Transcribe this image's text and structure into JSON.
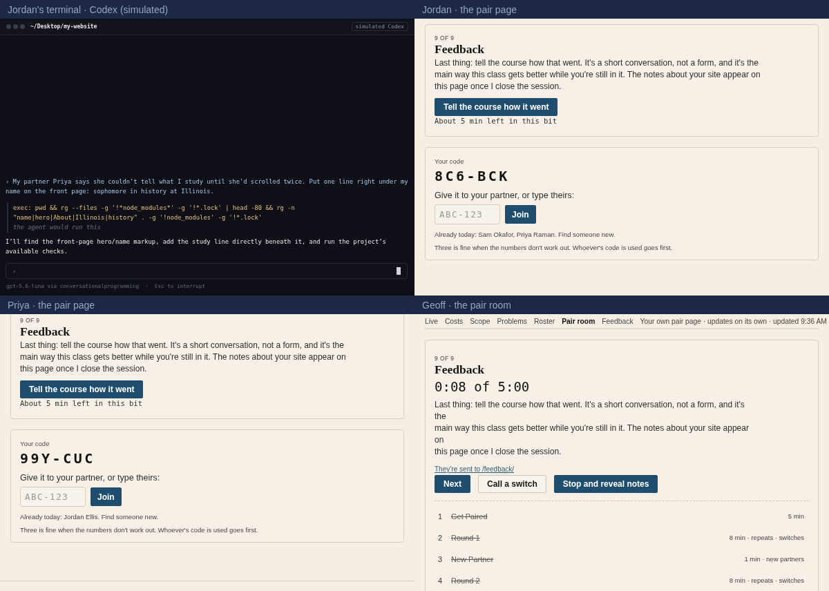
{
  "panes": [
    {
      "kind": "terminal",
      "title": "Jordan's terminal · Codex (simulated)",
      "terminal": {
        "path": "~/Desktop/my-website",
        "badge": "simulated Codex",
        "transcript": [
          {
            "kind": "user",
            "text": "› My partner Priya says she couldn't tell what I study until she'd scrolled twice. Put one line right under my\nname on the front page: sophomore in history at Illinois."
          },
          {
            "kind": "exec",
            "text": "exec: pwd && rg --files -g '!*node_modules*' -g '!*.lock' | head -80 && rg -n\n\"name|hero|About|Illinois|history\" . -g '!node_modules' -g '!*.lock'",
            "note": "the agent would run this"
          },
          {
            "kind": "reply",
            "text": "I’ll find the front-page hero/name markup, add the study line directly beneath it, and run the project’s\navailable checks."
          }
        ],
        "input": {
          "prompt": "›"
        },
        "footer": "gpt-5.6-luna via conversationalprogramming  ·  Esc to interrupt"
      }
    },
    {
      "kind": "pair_page",
      "title": "Jordan · the pair page",
      "feedback": {
        "cut_off_top": false,
        "step": "9 OF 9",
        "heading": "Feedback",
        "text": "Last thing: tell the course how that went. It's a short conversation, not a form, and it's the\nmain way this class gets better while you're still in it. The notes about your site appear on\nthis page once I close the session.",
        "button": "Tell the course how it went",
        "time_left": "About 5 min left in this bit"
      },
      "code_card": {
        "label": "Your code",
        "code": "8C6-BCK",
        "prompt": "Give it to your partner, or type theirs:",
        "input": {
          "placeholder": "ABC-123"
        },
        "join": "Join",
        "already": "Already today: Sam Okafor, Priya Raman. Find someone new.",
        "note": "Three is fine when the numbers don't work out. Whoever's code is used goes first."
      }
    },
    {
      "kind": "pair_page",
      "title": "Priya · the pair page",
      "feedback": {
        "cut_off_top": true,
        "step": "9 OF 9",
        "heading": "Feedback",
        "text": "Last thing: tell the course how that went. It's a short conversation, not a form, and it's the\nmain way this class gets better while you're still in it. The notes about your site appear on\nthis page once I close the session.",
        "button": "Tell the course how it went",
        "time_left": "About 5 min left in this bit"
      },
      "code_card": {
        "label": "Your code",
        "code": "99Y-CUC",
        "prompt": "Give it to your partner, or type theirs:",
        "input": {
          "placeholder": "ABC-123"
        },
        "join": "Join",
        "already": "Already today: Jordan Ellis. Find someone new.",
        "note": "Three is fine when the numbers don't work out. Whoever's code is used goes first."
      }
    },
    {
      "kind": "pair_room",
      "title": "Geoff · the pair room",
      "nav": {
        "items": [
          {
            "label": "Live",
            "selected": false
          },
          {
            "label": "Costs",
            "selected": false
          },
          {
            "label": "Scope",
            "selected": false
          },
          {
            "label": "Problems",
            "selected": false
          },
          {
            "label": "Roster",
            "selected": false
          },
          {
            "label": "Pair room",
            "selected": true
          },
          {
            "label": "Feedback",
            "selected": false
          }
        ],
        "status": "Your own pair page · updates on its own · updated 9:36 AM"
      },
      "feedback": {
        "step": "9 OF 9",
        "heading": "Feedback",
        "timer": "0:08 of 5:00",
        "text": "Last thing: tell the course how that went. It's a short conversation, not a form, and it's\nthe\nmain way this class gets better while you're still in it. The notes about your site appear\non\nthis page once I close the session.",
        "link": "They’re sent to /feedback/",
        "buttons": [
          {
            "label": "Next",
            "kind": "primary"
          },
          {
            "label": "Call a switch",
            "kind": "secondary"
          },
          {
            "label": "Stop and reveal notes",
            "kind": "primary"
          }
        ],
        "steps": [
          {
            "number": "1",
            "label": "Get Paired",
            "meta": "5 min",
            "done": true
          },
          {
            "number": "2",
            "label": "Round 1",
            "meta": "8 min · repeats · switches",
            "done": true
          },
          {
            "number": "3",
            "label": "New Partner",
            "meta": "1 min · new partners",
            "done": true
          },
          {
            "number": "4",
            "label": "Round 2",
            "meta": "8 min · repeats · switches",
            "done": true
          }
        ]
      }
    }
  ]
}
